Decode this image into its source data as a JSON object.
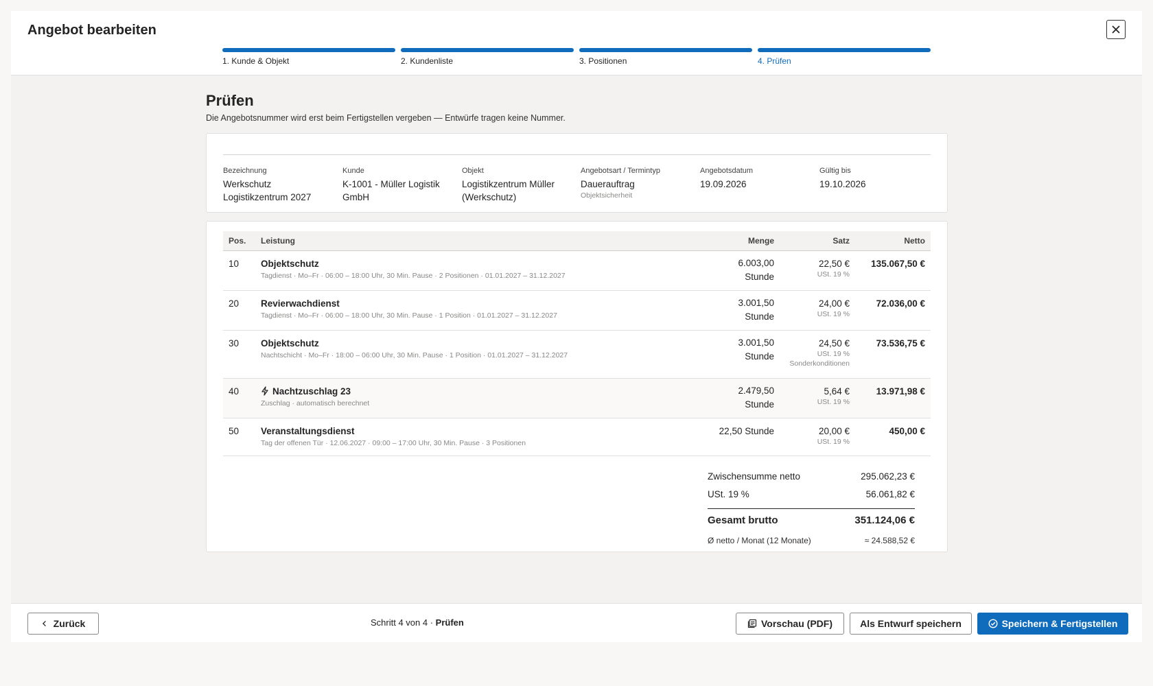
{
  "header": {
    "title": "Angebot bearbeiten",
    "close_icon": "close-icon"
  },
  "steps": [
    {
      "label": "1. Kunde & Objekt"
    },
    {
      "label": "2. Kundenliste"
    },
    {
      "label": "3. Positionen"
    },
    {
      "label": "4. Prüfen"
    }
  ],
  "page": {
    "title": "Prüfen",
    "subtitle": "Die Angebotsnummer wird erst beim Fertigstellen vergeben — Entwürfe tragen keine Nummer."
  },
  "info": {
    "bezeichnung_label": "Bezeichnung",
    "bezeichnung_value": "Werkschutz Logistikzentrum 2027",
    "kunde_label": "Kunde",
    "kunde_value": "K-1001 - Müller Logistik GmbH",
    "objekt_label": "Objekt",
    "objekt_value": "Logistikzentrum Müller (Werkschutz)",
    "art_label": "Angebotsart / Termintyp",
    "art_value": "Dauerauftrag",
    "art_sub": "Objektsicherheit",
    "datum_label": "Angebotsdatum",
    "datum_value": "19.09.2026",
    "gueltig_label": "Gültig bis",
    "gueltig_value": "19.10.2026"
  },
  "table": {
    "headers": {
      "pos": "Pos.",
      "leistung": "Leistung",
      "menge": "Menge",
      "satz": "Satz",
      "netto": "Netto"
    },
    "rows": [
      {
        "pos": "10",
        "name": "Objektschutz",
        "detail": "Tagdienst · Mo–Fr · 06:00 – 18:00 Uhr, 30 Min. Pause · 2 Positionen · 01.01.2027 – 31.12.2027",
        "menge": "6.003,00",
        "einheit": "Stunde",
        "satz": "22,50 €",
        "ust": "USt. 19 %",
        "extra": "",
        "netto": "135.067,50 €"
      },
      {
        "pos": "20",
        "name": "Revierwachdienst",
        "detail": "Tagdienst · Mo–Fr · 06:00 – 18:00 Uhr, 30 Min. Pause · 1 Position · 01.01.2027 – 31.12.2027",
        "menge": "3.001,50",
        "einheit": "Stunde",
        "satz": "24,00 €",
        "ust": "USt. 19 %",
        "extra": "",
        "netto": "72.036,00 €"
      },
      {
        "pos": "30",
        "name": "Objektschutz",
        "detail": "Nachtschicht · Mo–Fr · 18:00 – 06:00 Uhr, 30 Min. Pause · 1 Position · 01.01.2027 – 31.12.2027",
        "menge": "3.001,50",
        "einheit": "Stunde",
        "satz": "24,50 €",
        "ust": "USt. 19 %",
        "extra": "Sonderkonditionen",
        "netto": "73.536,75 €"
      },
      {
        "pos": "40",
        "name": "Nachtzuschlag 23",
        "detail": "Zuschlag · automatisch berechnet",
        "menge": "2.479,50",
        "einheit": "Stunde",
        "satz": "5,64 €",
        "ust": "USt. 19 %",
        "extra": "",
        "netto": "13.971,98 €"
      },
      {
        "pos": "50",
        "name": "Veranstaltungsdienst",
        "detail": "Tag der offenen Tür · 12.06.2027 · 09:00 – 17:00 Uhr, 30 Min. Pause · 3 Positionen",
        "menge": "22,50 Stunde",
        "einheit": "",
        "satz": "20,00 €",
        "ust": "USt. 19 %",
        "extra": "",
        "netto": "450,00 €"
      }
    ]
  },
  "totals": {
    "zwischensumme_label": "Zwischensumme netto",
    "zwischensumme_value": "295.062,23 €",
    "ust_label": "USt. 19 %",
    "ust_value": "56.061,82 €",
    "gesamt_label": "Gesamt brutto",
    "gesamt_value": "351.124,06 €",
    "monat_label": "Ø netto / Monat (12 Monate)",
    "monat_value": "≈ 24.588,52 €"
  },
  "footer": {
    "back_label": "Zurück",
    "step_prefix": "Schritt 4 von 4 · ",
    "step_name": "Prüfen",
    "preview_label": "Vorschau (PDF)",
    "draft_label": "Als Entwurf speichern",
    "finish_label": "Speichern & Fertigstellen"
  },
  "colors": {
    "accent": "#0f6cbd"
  }
}
